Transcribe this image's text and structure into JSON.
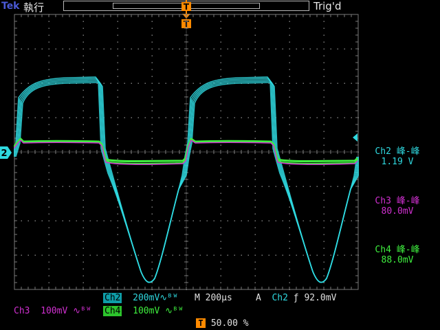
{
  "header": {
    "brand": "Tek",
    "state": "執行",
    "trigger_status": "Trig'd"
  },
  "colors": {
    "ch2": "#2fd9e0",
    "ch3": "#d030d0",
    "ch4": "#3ff03f",
    "trigger": "#ff8a00",
    "grid": "#7a7a7a"
  },
  "markers": {
    "trigger_t": "T",
    "ground_ch2": "2"
  },
  "measurements": [
    {
      "label": "Ch2 峰-峰",
      "value": "1.19 V",
      "color": "#2fd9e0"
    },
    {
      "label": "Ch3 峰-峰",
      "value": "80.0mV",
      "color": "#d030d0"
    },
    {
      "label": "Ch4 峰-峰",
      "value": "88.0mV",
      "color": "#3ff03f"
    }
  ],
  "bottom": {
    "ch2_label": "Ch2",
    "ch2_scale": "200mV",
    "bw_symbol": "∿ᴮᵂ",
    "timebase_label": "M",
    "timebase": "200µs",
    "acq_mode": "A",
    "trig_source": "Ch2",
    "trig_slope": "ƒ",
    "trig_level": "92.0mV",
    "ch3_label": "Ch3",
    "ch3_scale": "100mV",
    "ch4_label": "Ch4",
    "ch4_scale": "100mV",
    "trig_pos_icon": "T",
    "trig_pos": "50.00 %"
  }
}
